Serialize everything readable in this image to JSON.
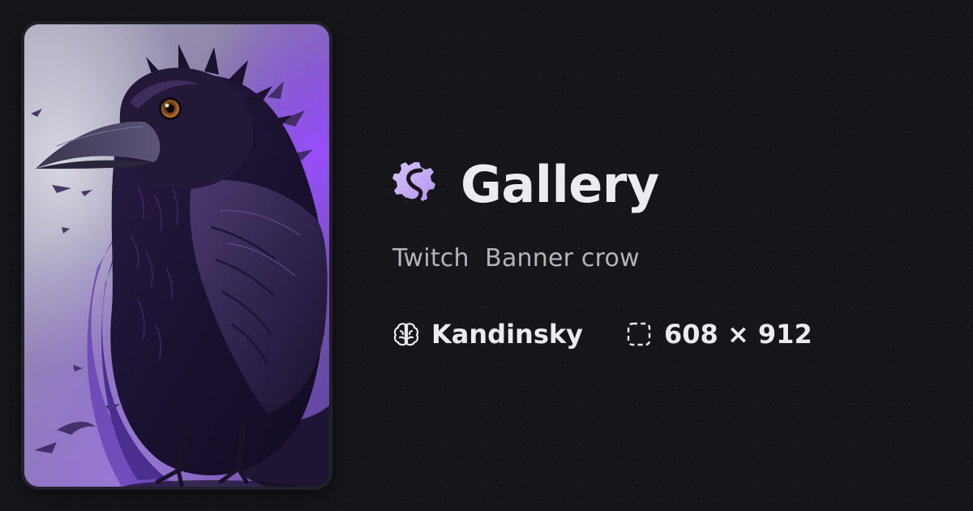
{
  "title": "Gallery",
  "subtitle": "Twitch  Banner crow",
  "meta": {
    "model": "Kandinsky",
    "dimensions": "608 × 912"
  },
  "icons": {
    "logo": "gallery-logo-icon",
    "model": "brain-icon",
    "dimensions": "selection-frame-icon"
  },
  "artwork": {
    "subject": "crow"
  },
  "colors": {
    "background": "#16151a",
    "accent": "#c4a7f5",
    "text": "#ecebf2",
    "muted_text": "#b4b3be"
  }
}
